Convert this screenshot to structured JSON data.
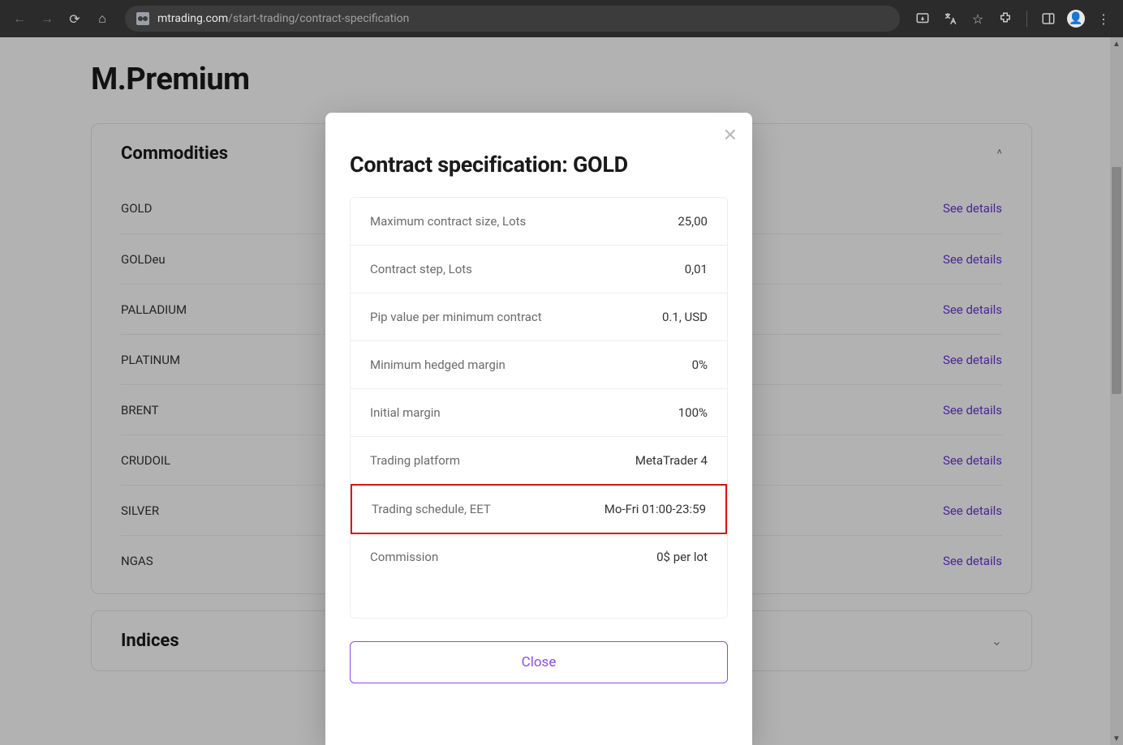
{
  "browser": {
    "url_host": "mtrading.com",
    "url_path": "/start-trading/contract-specification"
  },
  "page": {
    "title": "M.Premium",
    "sections": [
      {
        "title": "Commodities",
        "expanded": true,
        "items": [
          {
            "name": "GOLD",
            "action": "See details"
          },
          {
            "name": "GOLDeu",
            "action": "See details"
          },
          {
            "name": "PALLADIUM",
            "action": "See details"
          },
          {
            "name": "PLATINUM",
            "action": "See details"
          },
          {
            "name": "BRENT",
            "action": "See details"
          },
          {
            "name": "CRUDOIL",
            "action": "See details"
          },
          {
            "name": "SILVER",
            "action": "See details"
          },
          {
            "name": "NGAS",
            "action": "See details"
          }
        ]
      },
      {
        "title": "Indices",
        "expanded": false
      }
    ]
  },
  "modal": {
    "title": "Contract specification: GOLD",
    "close_label": "Close",
    "specs": [
      {
        "label": "Maximum contract size, Lots",
        "value": "25,00"
      },
      {
        "label": "Contract step, Lots",
        "value": "0,01"
      },
      {
        "label": "Pip value per minimum contract",
        "value": "0.1, USD"
      },
      {
        "label": "Minimum hedged margin",
        "value": "0%"
      },
      {
        "label": "Initial margin",
        "value": "100%"
      },
      {
        "label": "Trading platform",
        "value": "MetaTrader 4"
      },
      {
        "label": "Trading schedule, EET",
        "value": "Mo-Fri 01:00-23:59",
        "highlight": true
      },
      {
        "label": "Commission",
        "value": "0$ per lot"
      }
    ]
  }
}
